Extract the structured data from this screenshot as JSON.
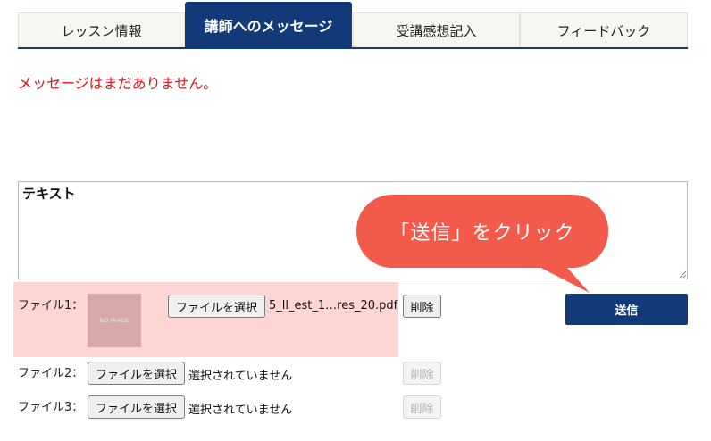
{
  "tabs": [
    {
      "label": "レッスン情報"
    },
    {
      "label": "講師へのメッセージ",
      "active": true
    },
    {
      "label": "受講感想記入"
    },
    {
      "label": "フィードバック"
    }
  ],
  "messages": {
    "empty_text": "メッセージはまだありません。"
  },
  "composer": {
    "placeholder": "テキスト"
  },
  "callout": {
    "text": "「送信」をクリック"
  },
  "send_button": {
    "label": "送信"
  },
  "files": [
    {
      "label": "ファイル1：",
      "choose_label": "ファイルを選択",
      "file_name": "5_ll_est_1…res_20.pdf",
      "delete_label": "削除",
      "thumbnail_text": "NO IMAGE",
      "highlighted": true
    },
    {
      "label": "ファイル2：",
      "choose_label": "ファイルを選択",
      "file_name": "選択されていません",
      "delete_label": "削除",
      "disabled_delete": true
    },
    {
      "label": "ファイル3：",
      "choose_label": "ファイルを選択",
      "file_name": "選択されていません",
      "delete_label": "削除",
      "disabled_delete": true
    }
  ],
  "colors": {
    "brand_navy": "#123a78",
    "alert_red": "#e0141e",
    "callout_red": "#f25a4c",
    "highlight_pink": "#fdd6d3"
  }
}
